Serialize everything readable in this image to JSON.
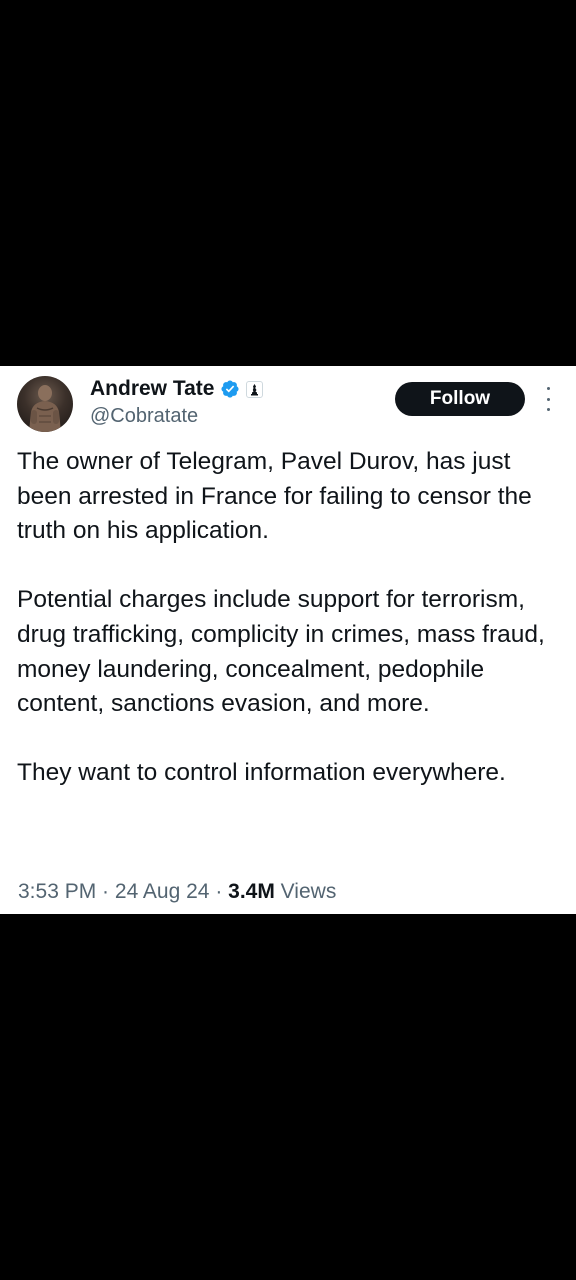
{
  "author": {
    "display_name": "Andrew Tate",
    "handle": "@Cobratate",
    "verified_icon": "verified-check-icon",
    "affiliate_badge": "♝"
  },
  "actions": {
    "follow_label": "Follow",
    "more_icon": "more-vertical-icon"
  },
  "tweet": {
    "paragraphs": [
      "The owner of Telegram, Pavel Durov, has just been arrested in France for failing to censor the truth on his application.",
      "Potential charges include support for terrorism, drug trafficking, complicity in crimes, mass fraud, money laundering, concealment, pedophile content, sanctions evasion, and more.",
      "They want to control information everywhere."
    ]
  },
  "meta": {
    "time": "3:53 PM",
    "sep1": " · ",
    "date": "24 Aug 24",
    "sep2": " · ",
    "views_count": "3.4M",
    "views_label": " Views"
  },
  "colors": {
    "background": "#000000",
    "card": "#ffffff",
    "text_primary": "#0f1419",
    "text_secondary": "#536471",
    "verified_blue": "#1d9bf0",
    "follow_button": "#0f1419"
  }
}
